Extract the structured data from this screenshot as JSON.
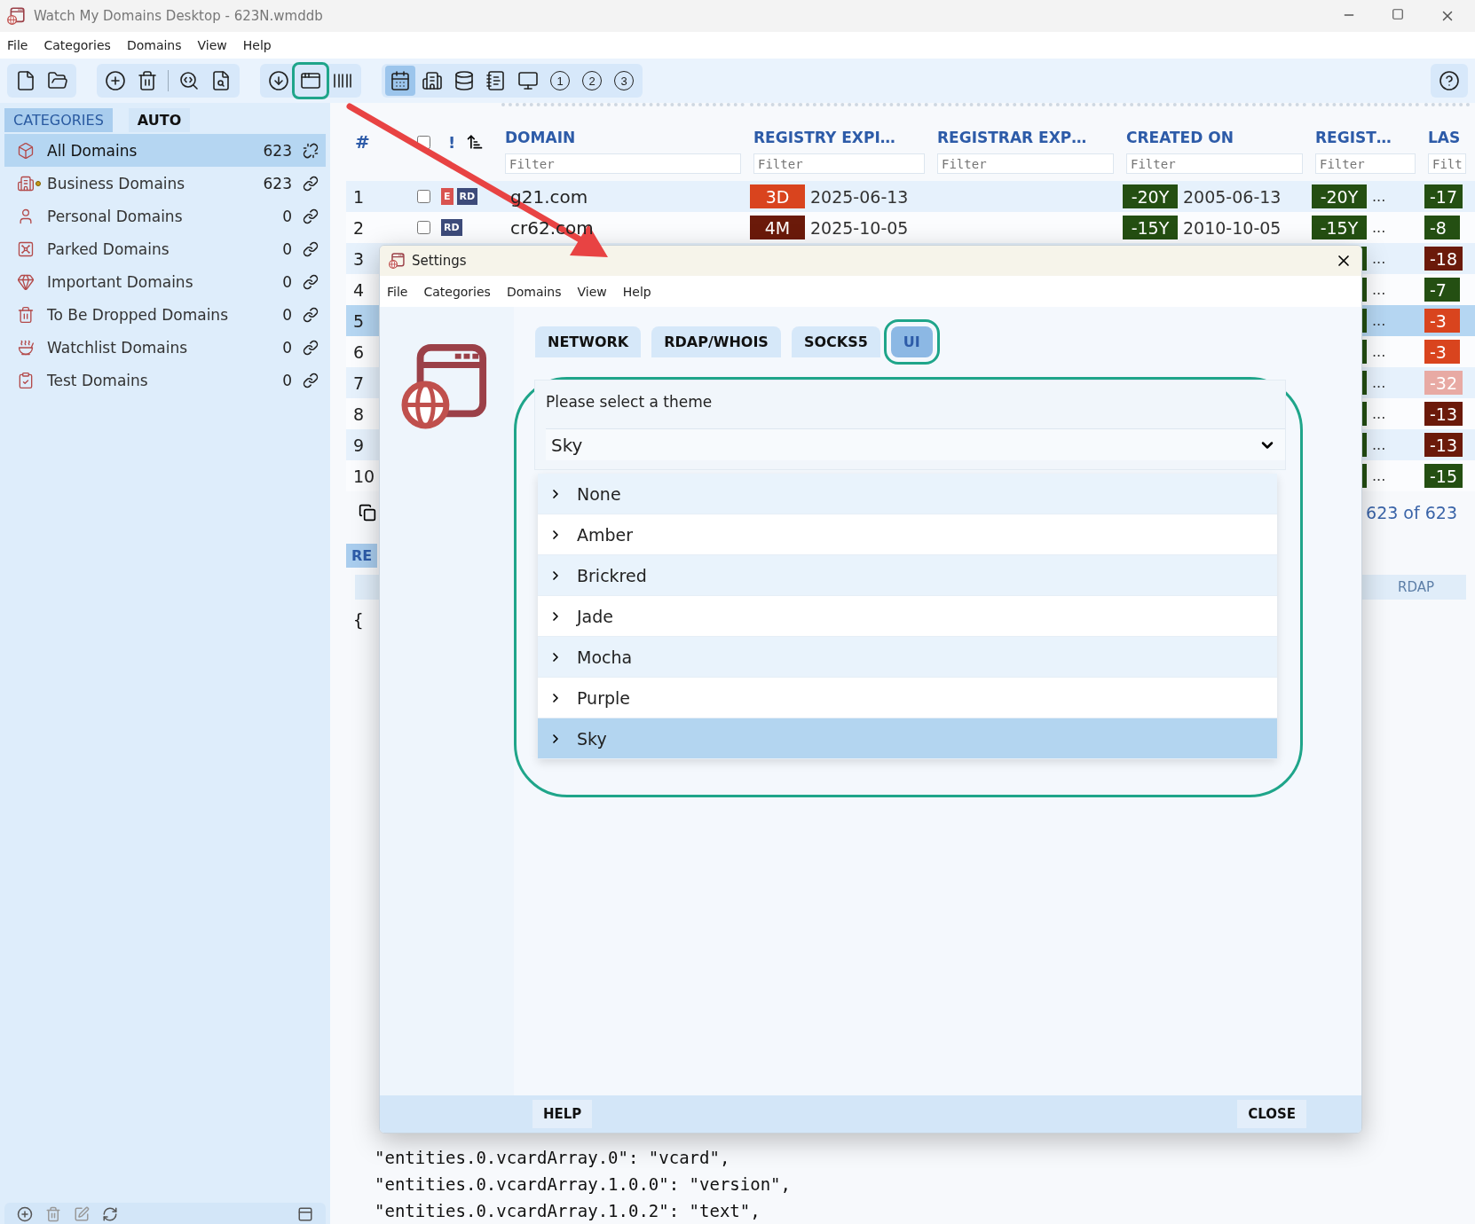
{
  "window": {
    "title": "Watch My Domains Desktop - 623N.wmddb"
  },
  "menu": [
    "File",
    "Categories",
    "Domains",
    "View",
    "Help"
  ],
  "toolbar": [
    [
      {
        "kind": "new-file",
        "selected": false,
        "highlighted": false
      },
      {
        "kind": "open-folder",
        "selected": false,
        "highlighted": false
      }
    ],
    [
      {
        "kind": "add",
        "selected": false,
        "highlighted": false
      },
      {
        "kind": "delete",
        "selected": false,
        "highlighted": false
      },
      {
        "kind": "divider"
      },
      {
        "kind": "search-web",
        "selected": false,
        "highlighted": false
      },
      {
        "kind": "search-doc",
        "selected": false,
        "highlighted": false
      }
    ],
    [
      {
        "kind": "download",
        "selected": false,
        "highlighted": false
      },
      {
        "kind": "settings",
        "selected": false,
        "highlighted": true
      },
      {
        "kind": "barcode",
        "selected": false,
        "highlighted": false
      }
    ],
    [
      {
        "kind": "calendar",
        "selected": true,
        "highlighted": false
      },
      {
        "kind": "building",
        "selected": false,
        "highlighted": false
      },
      {
        "kind": "database",
        "selected": false,
        "highlighted": false
      },
      {
        "kind": "notes",
        "selected": false,
        "highlighted": false
      },
      {
        "kind": "monitor",
        "selected": false,
        "highlighted": false
      },
      {
        "kind": "number",
        "label": "1",
        "selected": false,
        "highlighted": false
      },
      {
        "kind": "number",
        "label": "2",
        "selected": false,
        "highlighted": false
      },
      {
        "kind": "number",
        "label": "3",
        "selected": false,
        "highlighted": false
      }
    ]
  ],
  "sidebar": {
    "tabs": [
      {
        "label": "CATEGORIES",
        "selected": true
      },
      {
        "label": "AUTO",
        "selected": false
      }
    ],
    "items": [
      {
        "kind": "box",
        "label": "All Domains",
        "count": "623",
        "selected": true,
        "linked": false,
        "marked": false
      },
      {
        "kind": "building",
        "label": "Business Domains",
        "count": "623",
        "selected": false,
        "linked": true,
        "marked": true
      },
      {
        "kind": "person",
        "label": "Personal Domains",
        "count": "0",
        "selected": false,
        "linked": true,
        "marked": false
      },
      {
        "kind": "safe",
        "label": "Parked Domains",
        "count": "0",
        "selected": false,
        "linked": true,
        "marked": false
      },
      {
        "kind": "gem",
        "label": "Important Domains",
        "count": "0",
        "selected": false,
        "linked": true,
        "marked": false
      },
      {
        "kind": "trash",
        "label": "To Be Dropped Domains",
        "count": "0",
        "selected": false,
        "linked": true,
        "marked": false
      },
      {
        "kind": "bowl",
        "label": "Watchlist Domains",
        "count": "0",
        "selected": false,
        "linked": true,
        "marked": false
      },
      {
        "kind": "clipboard",
        "label": "Test Domains",
        "count": "0",
        "selected": false,
        "linked": true,
        "marked": false
      }
    ]
  },
  "table": {
    "number_heading": "#",
    "all_checked": false,
    "flag_heading": "!",
    "columns": [
      {
        "label": "DOMAIN",
        "placeholder": "Filter"
      },
      {
        "label": "REGISTRY EXPI…",
        "placeholder": "Filter"
      },
      {
        "label": "REGISTRAR EXP…",
        "placeholder": "Filter"
      },
      {
        "label": "CREATED ON",
        "placeholder": "Filter"
      },
      {
        "label": "REGIST…",
        "placeholder": "Filter"
      },
      {
        "label": "LAS",
        "placeholder": "Filt"
      }
    ],
    "rows": [
      {
        "number": "1",
        "selected": false,
        "checked": false,
        "flags": [
          {
            "label": "E",
            "color": "#d9534f"
          },
          {
            "label": "RD",
            "color": "#3d4b7a"
          }
        ],
        "domain": "g21.com",
        "registry": {
          "badge": "3D",
          "color": "#d9441e",
          "date": "2025-06-13"
        },
        "created": {
          "badge": "-20Y",
          "color": "#244f12",
          "date": "2005-06-13"
        },
        "regist": {
          "badge": "-20Y",
          "color": "#244f12",
          "more": "..."
        },
        "last": {
          "badge": "-17",
          "color": "#244f12"
        }
      },
      {
        "number": "2",
        "selected": false,
        "checked": false,
        "flags": [
          {
            "label": "RD",
            "color": "#3d4b7a"
          }
        ],
        "domain": "cr62.com",
        "registry": {
          "badge": "4M",
          "color": "#6b1a0a",
          "date": "2025-10-05"
        },
        "created": {
          "badge": "-15Y",
          "color": "#244f12",
          "date": "2010-10-05"
        },
        "regist": {
          "badge": "-15Y",
          "color": "#244f12",
          "more": "..."
        },
        "last": {
          "badge": "-8",
          "color": "#244f12"
        }
      },
      {
        "number": "3",
        "selected": false,
        "regist": {
          "color": "#244f12",
          "more": "..."
        },
        "last": {
          "badge": "-18",
          "color": "#6b1a0a"
        }
      },
      {
        "number": "4",
        "selected": false,
        "regist": {
          "color": "#244f12",
          "more": "..."
        },
        "last": {
          "badge": "-7",
          "color": "#244f12"
        }
      },
      {
        "number": "5",
        "selected": true,
        "regist": {
          "color": "#244f12",
          "more": "..."
        },
        "last": {
          "badge": "-3",
          "color": "#d9441e"
        }
      },
      {
        "number": "6",
        "selected": false,
        "regist": {
          "color": "#244f12",
          "more": "..."
        },
        "last": {
          "badge": "-3",
          "color": "#d9441e"
        }
      },
      {
        "number": "7",
        "selected": false,
        "regist": {
          "color": "#244f12",
          "more": "..."
        },
        "last": {
          "badge": "-32",
          "color": "#e8aaa4"
        }
      },
      {
        "number": "8",
        "selected": false,
        "regist": {
          "color": "#244f12",
          "more": "..."
        },
        "last": {
          "badge": "-13",
          "color": "#6b1a0a"
        }
      },
      {
        "number": "9",
        "selected": false,
        "regist": {
          "color": "#244f12",
          "more": "..."
        },
        "last": {
          "badge": "-13",
          "color": "#6b1a0a"
        }
      },
      {
        "number": "10",
        "selected": false,
        "regist": {
          "color": "#244f12",
          "more": "..."
        },
        "last": {
          "badge": "-15",
          "color": "#244f12"
        }
      }
    ],
    "footer": "623 of 623"
  },
  "details": {
    "tab": "RE",
    "header": "RDAP",
    "open_brace": "{",
    "lines": [
      "\"entities.0.vcardArray.0\": \"vcard\",",
      "\"entities.0.vcardArray.1.0.0\": \"version\",",
      "\"entities.0.vcardArray.1.0.2\": \"text\","
    ]
  },
  "dialog": {
    "title": "Settings",
    "menu": [
      "File",
      "Categories",
      "Domains",
      "View",
      "Help"
    ],
    "tabs": [
      {
        "label": "NETWORK",
        "selected": false,
        "highlighted": false
      },
      {
        "label": "RDAP/WHOIS",
        "selected": false,
        "highlighted": false
      },
      {
        "label": "SOCKS5",
        "selected": false,
        "highlighted": false
      },
      {
        "label": "UI",
        "selected": true,
        "highlighted": true
      }
    ],
    "theme": {
      "label": "Please select a theme",
      "value": "Sky",
      "expanded": true,
      "highlighted": true,
      "options": [
        {
          "label": "None",
          "selected": false
        },
        {
          "label": "Amber",
          "selected": false
        },
        {
          "label": "Brickred",
          "selected": false
        },
        {
          "label": "Jade",
          "selected": false
        },
        {
          "label": "Mocha",
          "selected": false
        },
        {
          "label": "Purple",
          "selected": false
        },
        {
          "label": "Sky",
          "selected": true
        }
      ]
    },
    "buttons": [
      "HELP",
      "CLOSE"
    ]
  }
}
